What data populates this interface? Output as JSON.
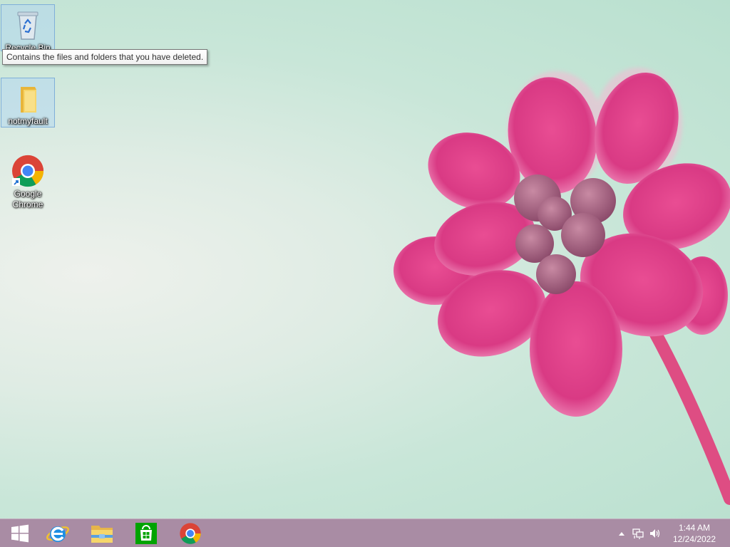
{
  "desktop": {
    "icons": [
      {
        "name": "Recycle Bin",
        "icon": "recycle-bin-icon"
      },
      {
        "name": "notmyfault",
        "icon": "folder-icon"
      },
      {
        "name": "Google Chrome",
        "icon": "chrome-shortcut-icon"
      }
    ],
    "tooltip": "Contains the files and folders that you have deleted."
  },
  "taskbar": {
    "pinned": [
      {
        "icon": "start-windows-icon"
      },
      {
        "icon": "internet-explorer-icon"
      },
      {
        "icon": "file-explorer-icon"
      },
      {
        "icon": "windows-store-icon"
      },
      {
        "icon": "chrome-icon"
      }
    ],
    "tray": {
      "icons": [
        "show-hidden-icons-arrow-icon",
        "network-icon",
        "volume-icon"
      ],
      "time": "1:44 AM",
      "date": "12/24/2022"
    }
  },
  "colors": {
    "taskbar": "#a98ca4",
    "flower": "#e0428a",
    "wallpaper": "#c8e6d8"
  }
}
